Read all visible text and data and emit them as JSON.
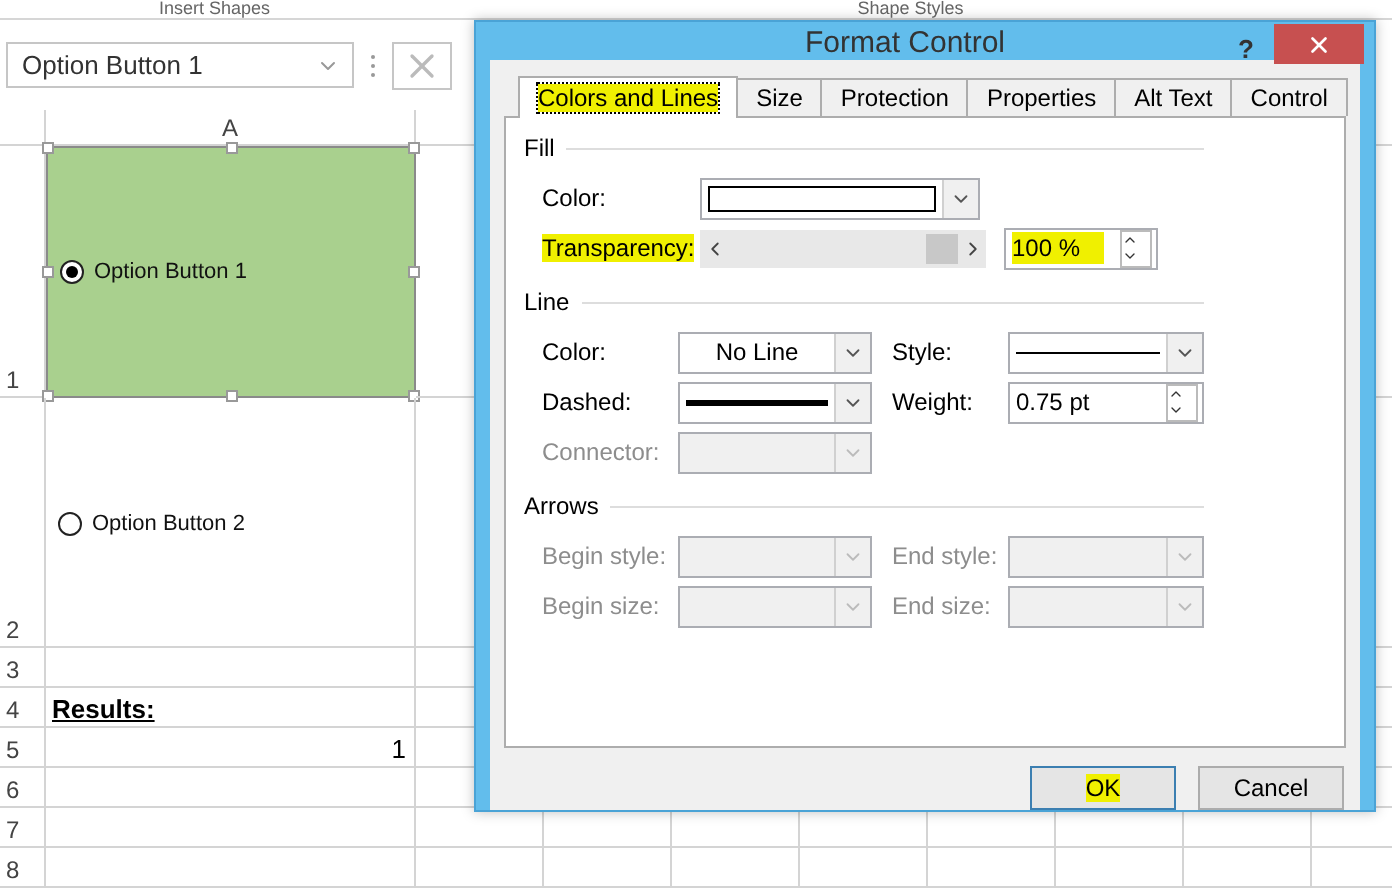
{
  "ribbon": {
    "groups": [
      "Insert Shapes",
      "Shape Styles"
    ]
  },
  "name_box": {
    "value": "Option Button 1"
  },
  "sheet": {
    "column_headers": [
      "A"
    ],
    "rows": [
      {
        "header": "1"
      },
      {
        "header": "2"
      },
      {
        "header": "3"
      },
      {
        "header": "4",
        "cell": {
          "text": "Results:",
          "kind": "heading"
        }
      },
      {
        "header": "5",
        "cell": {
          "text": "1",
          "kind": "number"
        }
      },
      {
        "header": "6"
      },
      {
        "header": "7"
      },
      {
        "header": "8"
      }
    ],
    "option_buttons": [
      {
        "label": "Option Button 1",
        "selected": true,
        "framed": true
      },
      {
        "label": "Option Button 2",
        "selected": false,
        "framed": false
      }
    ]
  },
  "dialog": {
    "title": "Format Control",
    "help": "?",
    "tabs": [
      {
        "label": "Colors and Lines",
        "selected": true,
        "highlighted": true
      },
      {
        "label": "Size",
        "selected": false,
        "highlighted": false
      },
      {
        "label": "Protection",
        "selected": false,
        "highlighted": false
      },
      {
        "label": "Properties",
        "selected": false,
        "highlighted": false
      },
      {
        "label": "Alt Text",
        "selected": false,
        "highlighted": false
      },
      {
        "label": "Control",
        "selected": false,
        "highlighted": false
      }
    ],
    "sections": [
      {
        "title": "Fill",
        "rows": [
          [
            {
              "label": "Color:",
              "kind": "swatch",
              "disabled": false,
              "highlighted": false
            }
          ],
          [
            {
              "label": "Transparency:",
              "kind": "slider",
              "level": 1,
              "value": "100 %",
              "disabled": false,
              "highlighted": true
            }
          ]
        ]
      },
      {
        "title": "Line",
        "rows": [
          [
            {
              "label": "Color:",
              "kind": "dropdown",
              "value": "No Line",
              "disabled": false,
              "highlighted": false
            },
            {
              "label": "Style:",
              "kind": "thinline",
              "disabled": false,
              "highlighted": false
            }
          ],
          [
            {
              "label": "Dashed:",
              "kind": "thickline",
              "disabled": false,
              "highlighted": false
            },
            {
              "label": "Weight:",
              "kind": "spin",
              "value": "0.75 pt",
              "disabled": false,
              "highlighted": false
            }
          ],
          [
            {
              "label": "Connector:",
              "kind": "dropdown",
              "disabled": true,
              "highlighted": false
            }
          ]
        ]
      },
      {
        "title": "Arrows",
        "rows": [
          [
            {
              "label": "Begin style:",
              "kind": "dropdown",
              "disabled": true,
              "highlighted": false
            },
            {
              "label": "End style:",
              "kind": "dropdown",
              "disabled": true,
              "highlighted": false
            }
          ],
          [
            {
              "label": "Begin size:",
              "kind": "dropdown",
              "disabled": true,
              "highlighted": false
            },
            {
              "label": "End size:",
              "kind": "dropdown",
              "disabled": true,
              "highlighted": false
            }
          ]
        ]
      }
    ],
    "buttons": [
      {
        "label": "OK",
        "default": true,
        "highlighted": true
      },
      {
        "label": "Cancel",
        "default": false,
        "highlighted": false
      }
    ]
  }
}
